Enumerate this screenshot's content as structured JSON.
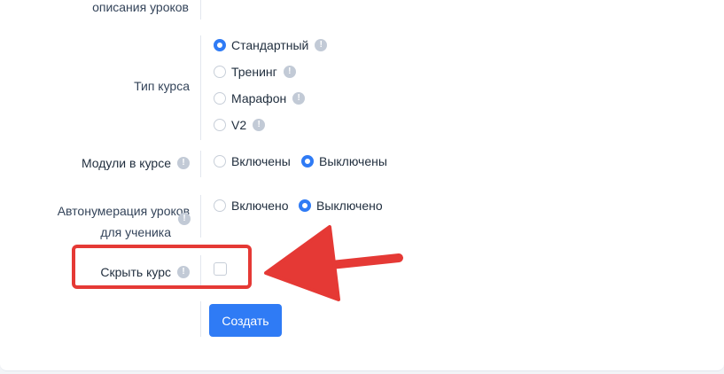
{
  "form": {
    "lesson_description_label": "описания уроков",
    "course_type": {
      "label": "Тип курса",
      "options": [
        {
          "label": "Стандартный",
          "selected": true
        },
        {
          "label": "Тренинг",
          "selected": false
        },
        {
          "label": "Марафон",
          "selected": false
        },
        {
          "label": "V2",
          "selected": false
        }
      ]
    },
    "modules": {
      "label": "Модули в курсе",
      "options": [
        {
          "label": "Включены",
          "selected": false
        },
        {
          "label": "Выключены",
          "selected": true
        }
      ]
    },
    "autonumbering": {
      "label_line1": "Автонумерация уроков",
      "label_line2": "для ученика",
      "options": [
        {
          "label": "Включено",
          "selected": false
        },
        {
          "label": "Выключено",
          "selected": true
        }
      ]
    },
    "hide_course": {
      "label": "Скрыть курс",
      "checked": false
    },
    "submit_label": "Создать",
    "info_glyph": "!"
  },
  "annotation": {
    "highlight_color": "#e53935",
    "arrow_color": "#e53935"
  },
  "colors": {
    "accent": "#2f7bf5",
    "info_icon": "#c2cad6"
  }
}
